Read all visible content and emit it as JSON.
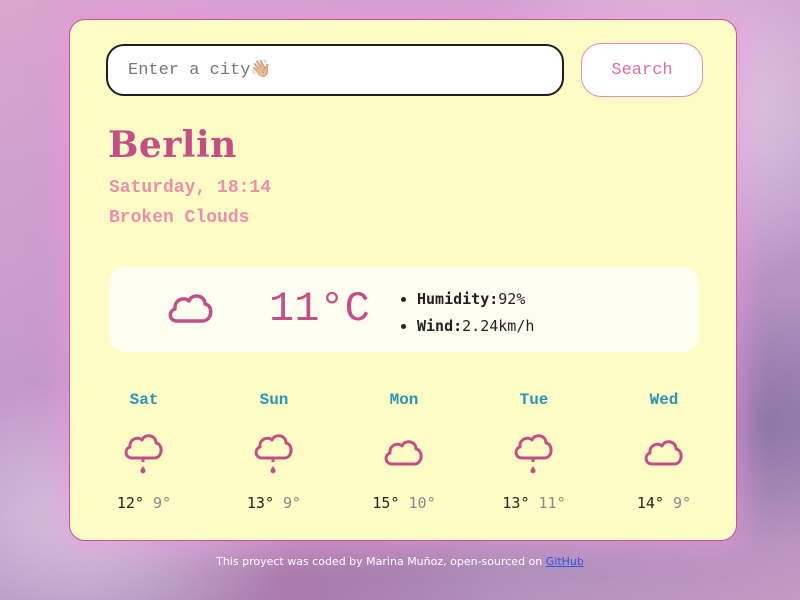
{
  "search": {
    "placeholder": "Enter a city👋🏼",
    "button_label": "Search"
  },
  "location": {
    "city": "Berlin",
    "datetime": "Saturday, 18:14",
    "description": "Broken Clouds"
  },
  "current": {
    "icon": "cloud-icon",
    "temperature": "11°C",
    "humidity_label": "Humidity:",
    "humidity_value": "92%",
    "wind_label": "Wind:",
    "wind_value": "2.24km/h"
  },
  "forecast": [
    {
      "day": "Sat",
      "icon": "rain-cloud-icon",
      "max": "12°",
      "min": "9°"
    },
    {
      "day": "Sun",
      "icon": "rain-cloud-icon",
      "max": "13°",
      "min": "9°"
    },
    {
      "day": "Mon",
      "icon": "cloud-icon",
      "max": "15°",
      "min": "10°"
    },
    {
      "day": "Tue",
      "icon": "rain-cloud-icon",
      "max": "13°",
      "min": "11°"
    },
    {
      "day": "Wed",
      "icon": "cloud-icon",
      "max": "14°",
      "min": "9°"
    }
  ],
  "footer": {
    "text": "This proyect was coded by Marina Muñoz, open-sourced on ",
    "link_label": "GitHub"
  },
  "colors": {
    "card_background": "#fdfcc6",
    "accent_pink": "#c34f86",
    "light_pink": "#ec8fac",
    "day_blue": "#2a95b5",
    "link_blue": "#2b56e6"
  }
}
